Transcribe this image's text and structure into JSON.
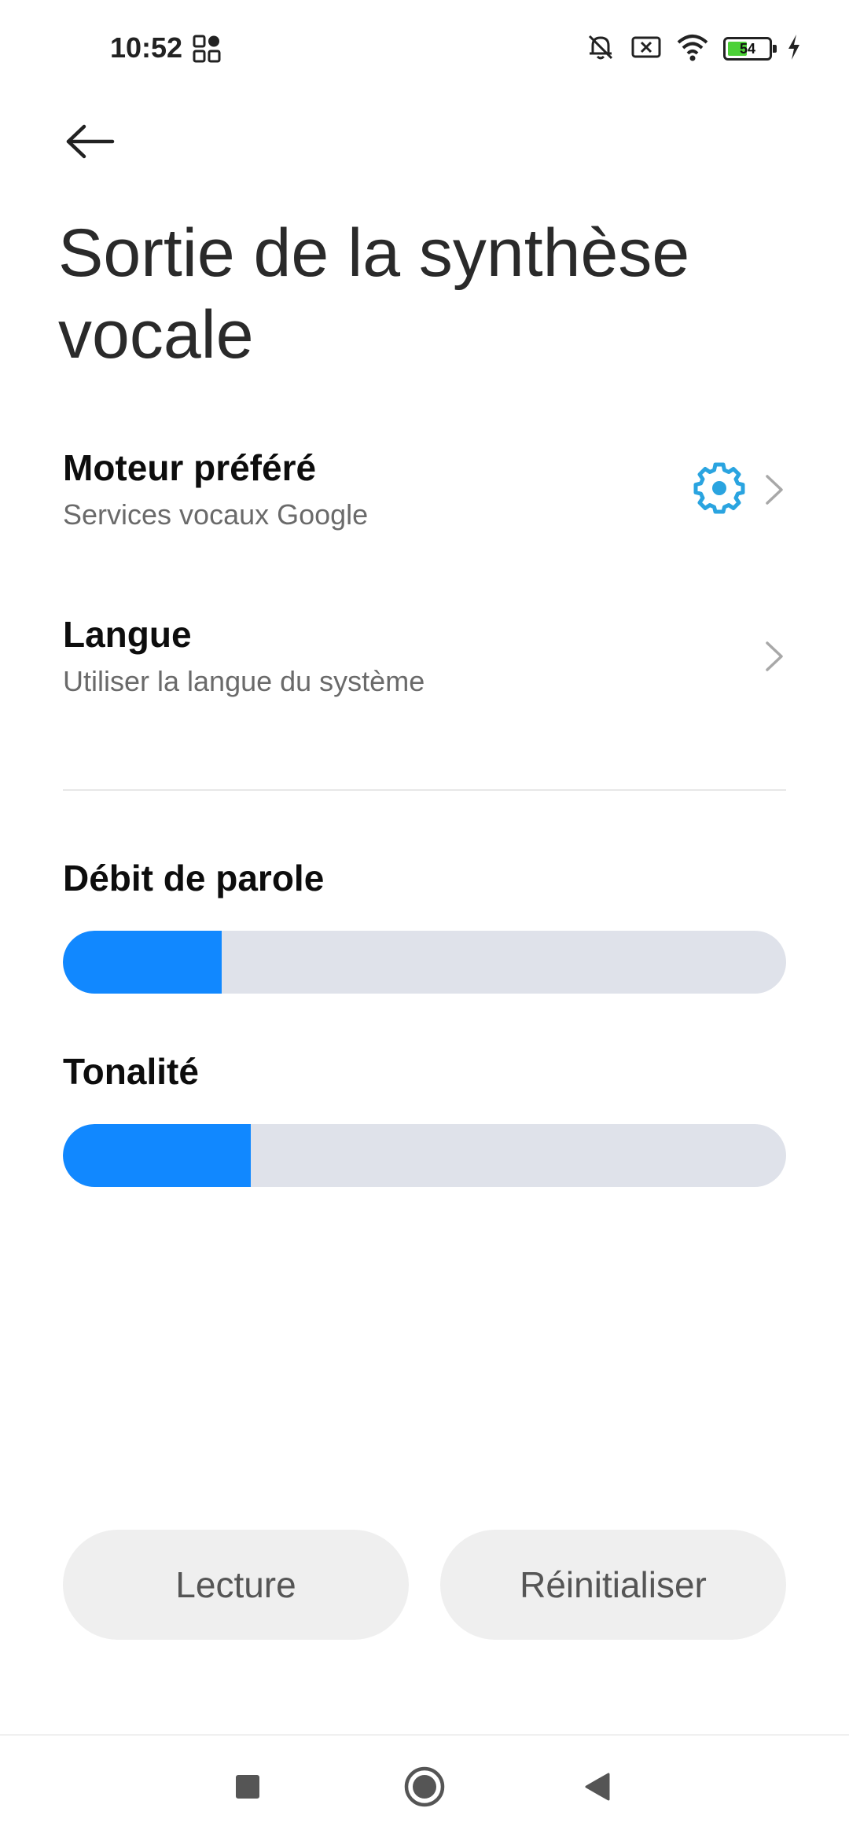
{
  "status_bar": {
    "time": "10:52",
    "battery_level": "54",
    "battery_fraction": 0.54,
    "icons": [
      "qr-code-icon",
      "silent-bell-icon",
      "no-sim-icon",
      "wifi-icon",
      "battery-icon",
      "charging-icon"
    ]
  },
  "header": {
    "back_icon": "back-arrow-icon",
    "title": "Sortie de la synthèse vocale"
  },
  "settings": {
    "engine": {
      "title": "Moteur préféré",
      "subtitle": "Services vocaux Google",
      "icon": "gear-icon"
    },
    "language": {
      "title": "Langue",
      "subtitle": "Utiliser la langue du système"
    }
  },
  "sliders": {
    "speech_rate": {
      "label": "Débit de parole",
      "value_fraction": 0.22
    },
    "pitch": {
      "label": "Tonalité",
      "value_fraction": 0.26
    }
  },
  "buttons": {
    "play_label": "Lecture",
    "reset_label": "Réinitialiser"
  },
  "nav_bar": {
    "icons": [
      "recents-icon",
      "home-icon",
      "back-triangle-icon"
    ]
  },
  "colors": {
    "accent": "#1188ff",
    "gear": "#2aa4e0",
    "slider_track": "#dfe2ea",
    "battery_fill": "#4cd137"
  }
}
